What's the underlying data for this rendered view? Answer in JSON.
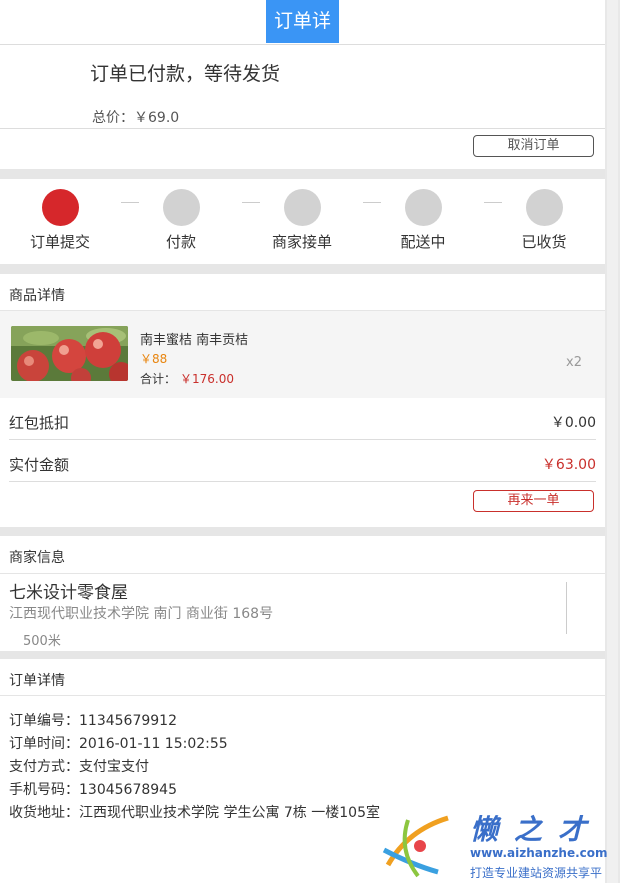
{
  "header": {
    "title": "订单详情"
  },
  "status": {
    "text": "订单已付款，等待发货",
    "total_label": "总价：",
    "total_value": "￥69.0",
    "cancel_label": "取消订单"
  },
  "steps": [
    {
      "label": "订单提交",
      "active": true
    },
    {
      "label": "付款",
      "active": false
    },
    {
      "label": "商家接单",
      "active": false
    },
    {
      "label": "配送中",
      "active": false
    },
    {
      "label": "已收货",
      "active": false
    }
  ],
  "product_section": {
    "title": "商品详情"
  },
  "product": {
    "name": "南丰蜜桔 南丰贡桔",
    "price": "￥88",
    "subtotal_label": "合计：",
    "subtotal_value": "￥176.00",
    "qty": "x2"
  },
  "summary": {
    "discount_label": "红包抵扣",
    "discount_value": "￥0.00",
    "paid_label": "实付金额",
    "paid_value": "￥63.00",
    "again_label": "再来一单"
  },
  "shop_section": {
    "title": "商家信息"
  },
  "shop": {
    "name": "七米设计零食屋",
    "address": "江西现代职业技术学院 南门 商业街 168号",
    "distance": "500米"
  },
  "order_section": {
    "title": "订单详情"
  },
  "order": {
    "number_label": "订单编号：",
    "number": "11345679912",
    "time_label": "订单时间：",
    "time": "2016-01-11 15:02:55",
    "payment_label": "支付方式：",
    "payment": "支付宝支付",
    "phone_label": "手机号码：",
    "phone": "13045678945",
    "address_label": "收货地址：",
    "address": "江西现代职业技术学院 学生公寓 7栋 一楼105室"
  },
  "watermark": {
    "title": "懒之才",
    "url": "www.aizhanzhe.com",
    "tagline": "打造专业建站资源共享平台"
  },
  "colors": {
    "accent": "#3a95f5",
    "active_step": "#d6272b",
    "price_red": "#c9302c",
    "price_orange": "#e8850f"
  }
}
